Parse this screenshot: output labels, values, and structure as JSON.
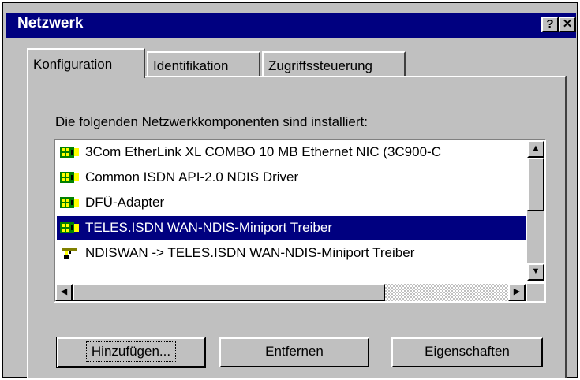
{
  "window": {
    "title": "Netzwerk",
    "help_label": "?",
    "close_label": "✕"
  },
  "tabs": [
    {
      "label": "Konfiguration"
    },
    {
      "label": "Identifikation"
    },
    {
      "label": "Zugriffssteuerung"
    }
  ],
  "panel": {
    "list_label": "Die folgenden Netzwerkkomponenten sind installiert:"
  },
  "components": [
    {
      "label": "3Com EtherLink XL COMBO 10 MB Ethernet NIC (3C900-C",
      "icon": "network-card-icon"
    },
    {
      "label": "Common ISDN API-2.0 NDIS Driver",
      "icon": "network-card-icon"
    },
    {
      "label": "DFÜ-Adapter",
      "icon": "network-card-icon"
    },
    {
      "label": "TELES.ISDN WAN-NDIS-Miniport Treiber",
      "icon": "network-card-icon",
      "selected": true
    },
    {
      "label": "NDISWAN -> TELES.ISDN WAN-NDIS-Miniport Treiber",
      "icon": "protocol-icon"
    }
  ],
  "buttons": {
    "add": "Hinzufügen...",
    "remove": "Entfernen",
    "properties": "Eigenschaften"
  },
  "colors": {
    "titlebar": "#000080",
    "selection": "#000080",
    "face": "#c0c0c0"
  }
}
